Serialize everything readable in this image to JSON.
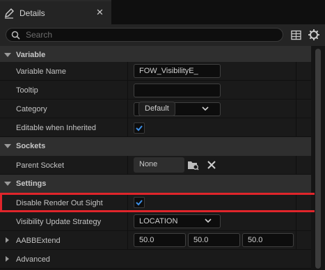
{
  "tab": {
    "title": "Details",
    "close_label": "✕",
    "icon": "pencil-icon"
  },
  "search": {
    "placeholder": "Search",
    "icons": [
      "search-icon",
      "table-icon",
      "gear-icon"
    ]
  },
  "categories": {
    "variable": "Variable",
    "sockets": "Sockets",
    "settings": "Settings",
    "advanced": "Advanced"
  },
  "properties": {
    "variable_name": {
      "label": "Variable Name",
      "value": "FOW_VisibilityE_"
    },
    "tooltip": {
      "label": "Tooltip",
      "value": ""
    },
    "category": {
      "label": "Category",
      "value": "Default"
    },
    "editable_when_inherited": {
      "label": "Editable when Inherited",
      "checked": true
    },
    "parent_socket": {
      "label": "Parent Socket",
      "value": "None"
    },
    "disable_render_out_sight": {
      "label": "Disable Render Out Sight",
      "checked": true
    },
    "visibility_update_strategy": {
      "label": "Visibility Update Strategy",
      "value": "LOCATION"
    },
    "aabb_extend": {
      "label": "AABBExtend",
      "x": "50.0",
      "y": "50.0",
      "z": "50.0"
    }
  },
  "colors": {
    "check_accent": "#3d8fe6",
    "highlight": "#e0252b",
    "panel_bg": "#1a1a1a",
    "category_bg": "#2f2f2f"
  }
}
